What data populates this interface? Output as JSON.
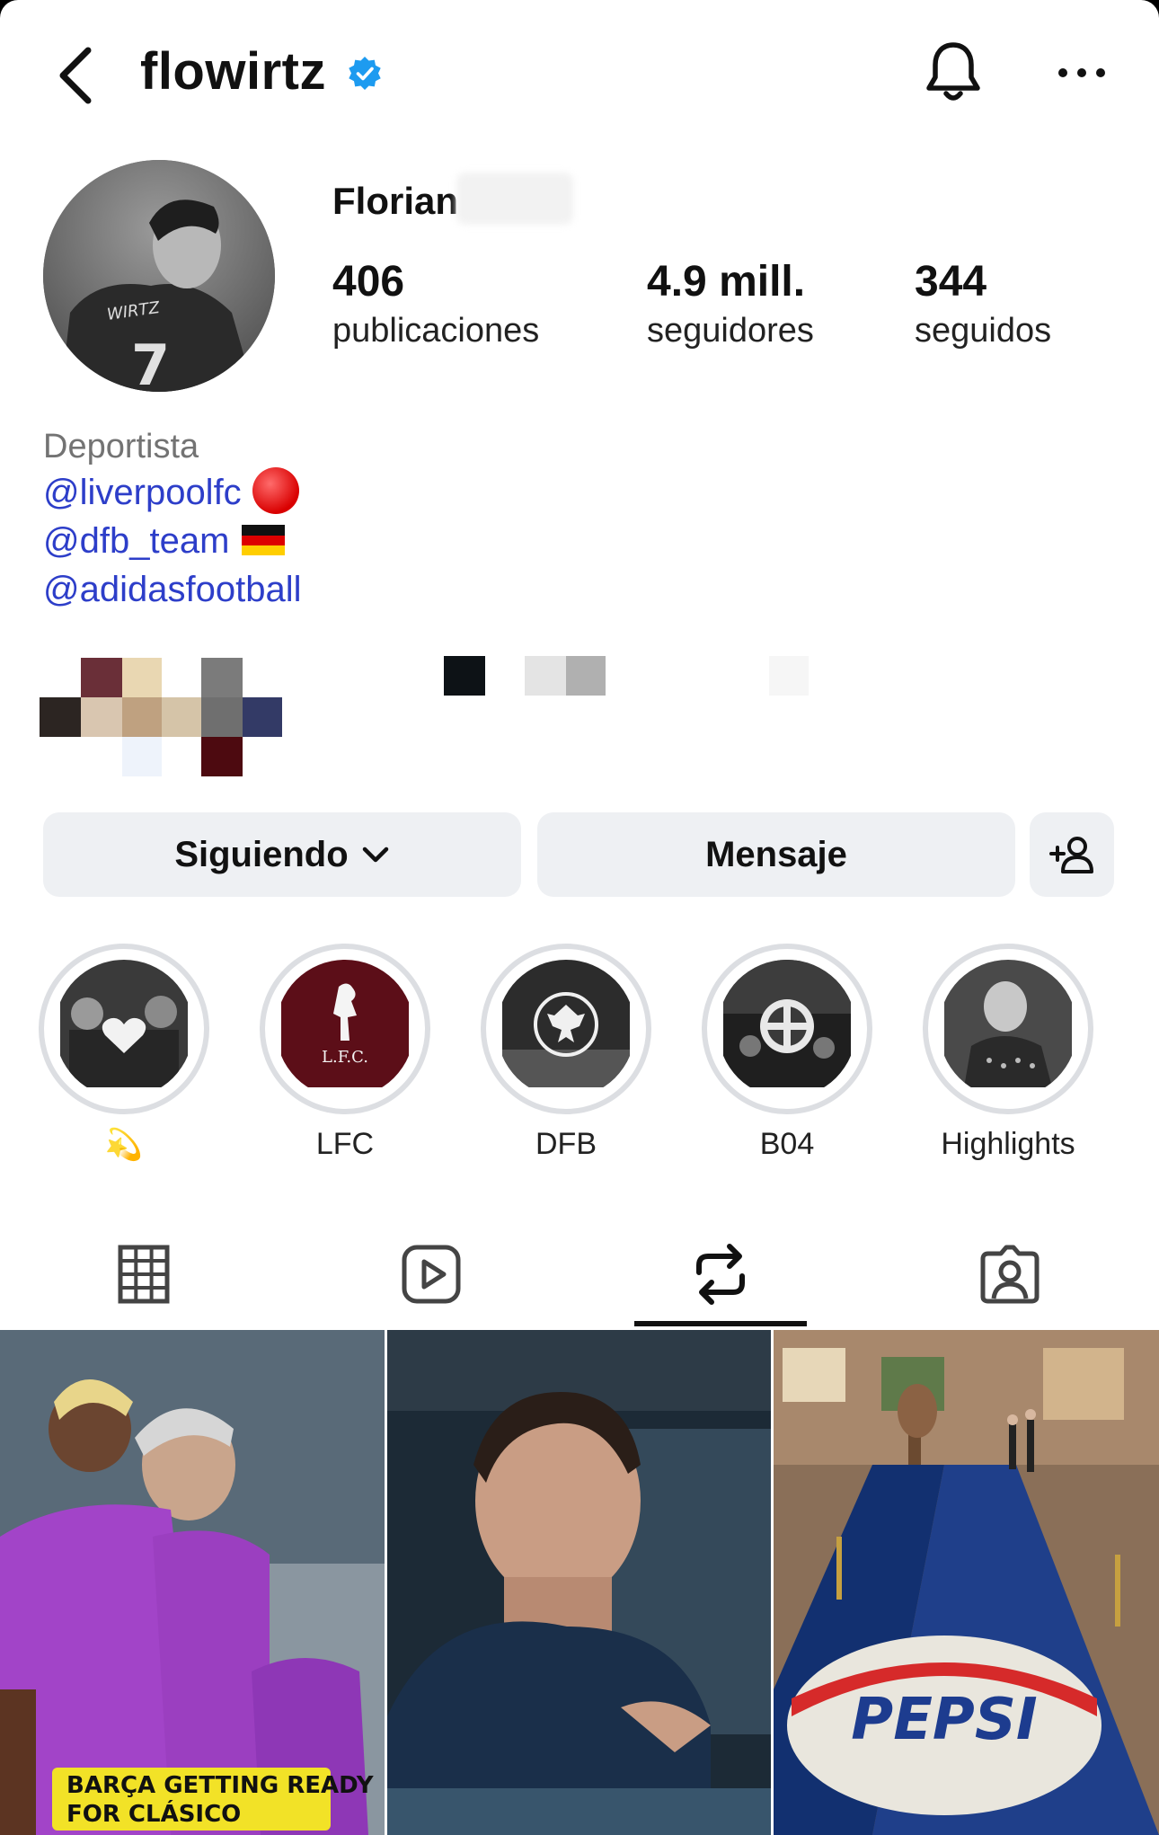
{
  "header": {
    "username": "flowirtz",
    "verified": true
  },
  "profile": {
    "display_name": "Florian",
    "stats": [
      {
        "value": "406",
        "label": "publicaciones"
      },
      {
        "value": "4.9 mill.",
        "label": "seguidores"
      },
      {
        "value": "344",
        "label": "seguidos"
      }
    ]
  },
  "bio": {
    "category": "Deportista",
    "links": [
      {
        "text": "@liverpoolfc",
        "emoji": "red-circle"
      },
      {
        "text": "@dfb_team",
        "emoji": "germany-flag"
      },
      {
        "text": "@adidasfootball",
        "emoji": ""
      }
    ]
  },
  "actions": {
    "following_label": "Siguiendo",
    "message_label": "Mensaje"
  },
  "highlights": [
    {
      "label": "💫"
    },
    {
      "label": "LFC"
    },
    {
      "label": "DFB"
    },
    {
      "label": "B04"
    },
    {
      "label": "Highlights"
    }
  ],
  "tabs": [
    "grid-icon",
    "reels-icon",
    "reposts-icon",
    "tagged-icon"
  ],
  "active_tab": "reposts-icon",
  "posts": [
    {
      "caption": "BARÇA GETTING READY FOR CLÁSICO"
    },
    {
      "caption": ""
    },
    {
      "caption": "PEPSI"
    }
  ],
  "colors": {
    "link": "#2d3ec9",
    "verified": "#1d9bf0",
    "button_bg": "#eef0f3"
  }
}
